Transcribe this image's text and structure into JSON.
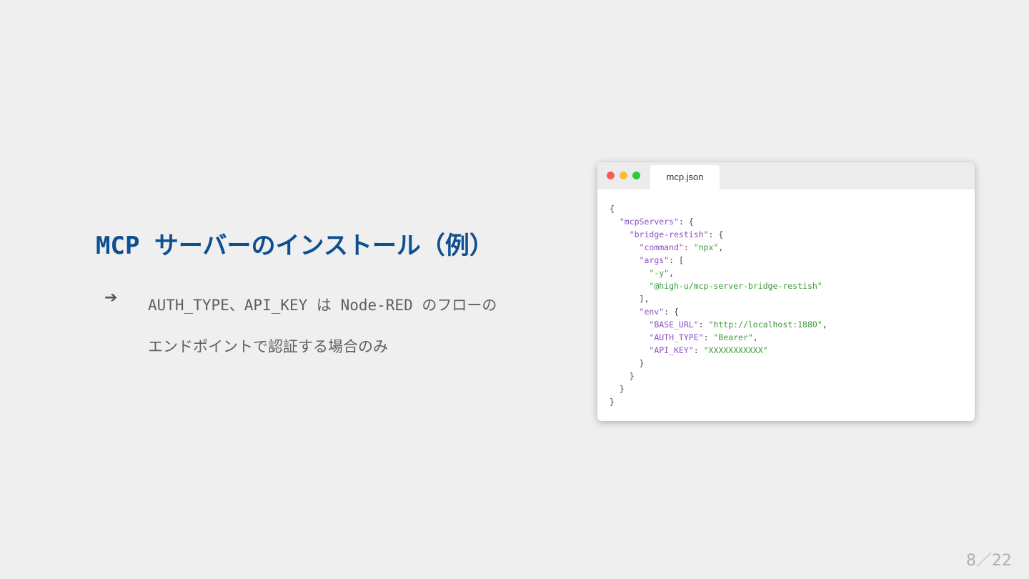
{
  "slide": {
    "title": "MCP サーバーのインストール（例）",
    "bullets": [
      {
        "marker": "➔",
        "lines": [
          "AUTH_TYPE、API_KEY は Node-RED のフローの",
          "エンドポイントで認証する場合のみ"
        ]
      }
    ]
  },
  "code_window": {
    "tab_label": "mcp.json",
    "window_controls": [
      "close-dot",
      "minimize-dot",
      "maximize-dot"
    ],
    "lines": [
      "{",
      "  \"mcpServers\": {",
      "    \"bridge-restish\": {",
      "      \"command\": \"npx\",",
      "      \"args\": [",
      "        \"-y\",",
      "        \"@high-u/mcp-server-bridge-restish\"",
      "      ],",
      "      \"env\": {",
      "        \"BASE_URL\": \"http://localhost:1880\",",
      "        \"AUTH_TYPE\": \"Bearer\",",
      "        \"API_KEY\": \"XXXXXXXXXXX\"",
      "      }",
      "    }",
      "  }",
      "}"
    ]
  },
  "pagination": {
    "label": "8／22"
  },
  "colors": {
    "title": "#0e4f8f",
    "json_key": "#8c4fc4",
    "json_string": "#3d9b3d",
    "background": "#efefef"
  }
}
